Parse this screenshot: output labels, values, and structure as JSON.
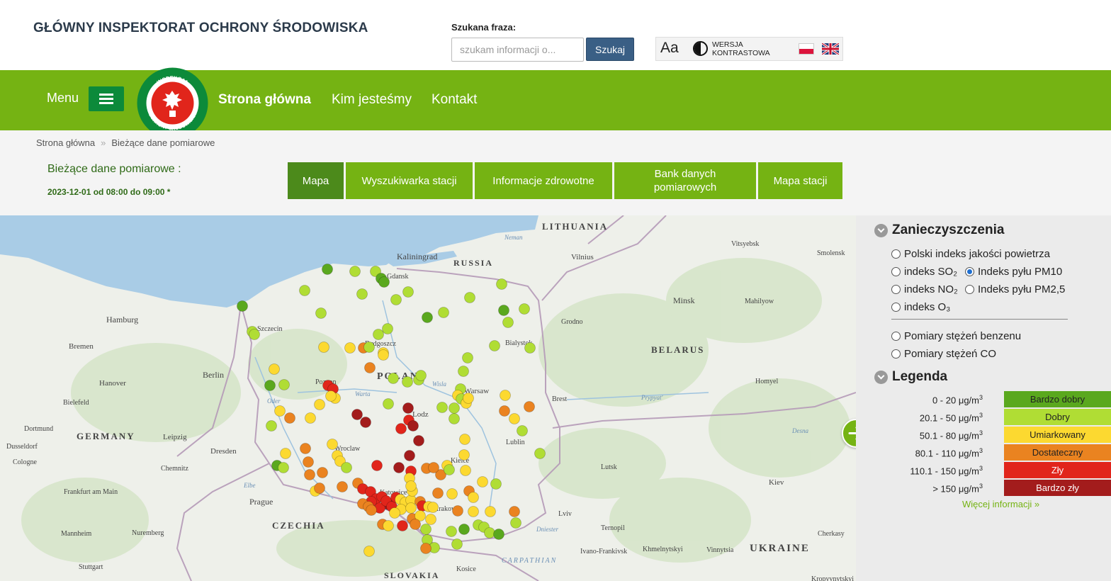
{
  "header": {
    "site_title": "GŁÓWNY INSPEKTORAT OCHRONY ŚRODOWISKA",
    "search_label": "Szukana fraza:",
    "search_placeholder": "szukam informacji o...",
    "search_button": "Szukaj",
    "font_size_button": "Aa",
    "contrast_label": "WERSJA KONTRASTOWA"
  },
  "nav": {
    "menu_label": "Menu",
    "logo_text_top": "INSPEKCJA",
    "logo_text_bottom": "OCHRONY ŚRODOWISKA",
    "links": [
      "Strona główna",
      "Kim jesteśmy",
      "Kontakt"
    ]
  },
  "breadcrumb": {
    "home": "Strona główna",
    "sep": "»",
    "current": "Bieżące dane pomiarowe"
  },
  "page": {
    "title": "Bieżące dane pomiarowe :",
    "timestamp": "2023-12-01 od 08:00 do 09:00 *"
  },
  "tabs": [
    "Mapa",
    "Wyszukiwarka stacji",
    "Informacje zdrowotne",
    "Bank danych pomiarowych",
    "Mapa stacji"
  ],
  "map": {
    "labels": [
      "LITHUANIA",
      "Neman",
      "Kaliningrad",
      "RUSSIA",
      "Vilnius",
      "Vitsyebsk",
      "Smolensk",
      "Gdansk",
      "Hamburg",
      "Szczecin",
      "Bydgoszcz",
      "Minsk",
      "Mahilyow",
      "Grodno",
      "Bialystok",
      "Bremen",
      "BELARUS",
      "Berlin",
      "Hanover",
      "POLAND",
      "Poznan",
      "Warta",
      "Wisla",
      "Warsaw",
      "Homyel",
      "Bielefeld",
      "Oder",
      "Brest",
      "Prypyatʹ",
      "Lodz",
      "GERMANY",
      "Dortmund",
      "Dusseldorf",
      "Leipzig",
      "Desna",
      "Lublin",
      "Wroclaw",
      "Dresden",
      "Cologne",
      "Chemnitz",
      "Kielce",
      "Lutsk",
      "Elbe",
      "Frankfurt am Main",
      "Prague",
      "Katowice",
      "Krakow",
      "Kiev",
      "Lviv",
      "CZECHIA",
      "Mannheim",
      "Nuremberg",
      "Ternopil",
      "Cherkasy",
      "Khmelnytskyi",
      "Vinnytsia",
      "Ivano-Frankivsk",
      "UKRAINE",
      "Stuttgart",
      "SLOVAKIA",
      "Kosice",
      "CARPATHIAN",
      "Kropyvnytskyi",
      "Dniester"
    ],
    "colors": {
      "bardzo_dobry": "#5aa81e",
      "dobry": "#b0dd34",
      "umiarkowany": "#fcd930",
      "dostateczny": "#ea8320",
      "zly": "#e1251b",
      "bardzo_zly": "#a31c1c"
    }
  },
  "panel": {
    "pollutants_title": "Zanieczyszczenia",
    "options": {
      "aqi": "Polski indeks jakości powietrza",
      "so2": "indeks SO₂",
      "pm10": "Indeks pyłu PM10",
      "no2": "indeks NO₂",
      "pm25": "Indeks pyłu PM2,5",
      "o3": "indeks O₃",
      "benzene": "Pomiary stężeń benzenu",
      "co": "Pomiary stężeń CO"
    },
    "selected": "pm10",
    "legend_title": "Legenda",
    "legend": [
      {
        "range": "0 - 20 μg/m",
        "label": "Bardzo dobry",
        "color": "#5aa81e"
      },
      {
        "range": "20.1 - 50 μg/m",
        "label": "Dobry",
        "color": "#b0dd34"
      },
      {
        "range": "50.1 - 80 μg/m",
        "label": "Umiarkowany",
        "color": "#fcd930"
      },
      {
        "range": "80.1 - 110 μg/m",
        "label": "Dostateczny",
        "color": "#ea8320"
      },
      {
        "range": "110.1 - 150 μg/m",
        "label": "Zły",
        "color": "#e1251b"
      },
      {
        "range": "> 150 μg/m",
        "label": "Bardzo zły",
        "color": "#a31c1c"
      }
    ],
    "legend_unit_sup": "3",
    "more_link": "Więcej informacji »"
  }
}
